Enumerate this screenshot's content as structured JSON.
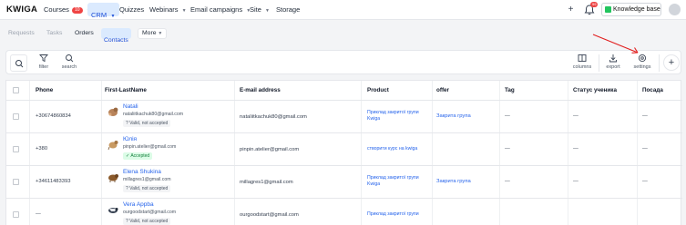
{
  "app": {
    "logo": "KWIGA"
  },
  "topnav": {
    "items": [
      {
        "label": "Courses",
        "badge": "10",
        "chevron": true
      },
      {
        "label": "CRM",
        "chevron": true,
        "active": true
      },
      {
        "label": "Quizzes"
      },
      {
        "label": "Webinars",
        "chevron": true
      },
      {
        "label": "Email campaigns",
        "chevron": true
      },
      {
        "label": "Site",
        "chevron": true
      },
      {
        "label": "Storage"
      }
    ],
    "plus_label": "+",
    "bell_badge": "99",
    "knowledge_base": "Knowledge base"
  },
  "subtabs": {
    "items": [
      "Requests",
      "Tasks",
      "Orders",
      "Contacts"
    ],
    "active": "Contacts",
    "more_label": "More"
  },
  "toolbar": {
    "filter": "filter",
    "search": "search",
    "columns": "columns",
    "export": "export",
    "settings": "settings",
    "add": "+"
  },
  "table": {
    "headers": [
      "Phone",
      "First-LastName",
      "E-mail address",
      "Product",
      "offer",
      "Tag",
      "Статус ученика",
      "Посада"
    ],
    "rows": [
      {
        "phone": "+30674860834",
        "name": "Natali",
        "email_small": "nataliitkachuk80@gmail.com",
        "status": "Valid, not accepted",
        "status_ok": false,
        "email": "nataliitkachuk80@gmail.com",
        "product": [
          "Приклад закритої групи",
          "Kwiga"
        ],
        "offer": "Закрита група",
        "tag": "—",
        "student_status": "—",
        "position": "—"
      },
      {
        "phone": "+380",
        "name": "Юлія",
        "email_small": "pinpin.atelier@gmail.com",
        "status": "Accepted",
        "status_ok": true,
        "email": "pinpin.atelier@gmail.com",
        "product": [
          "створити курс на kwiga"
        ],
        "offer": "",
        "tag": "—",
        "student_status": "—",
        "position": "—"
      },
      {
        "phone": "+34611483393",
        "name": "Elena Shukina",
        "email_small": "millagres1@gmail.com",
        "status": "Valid, not accepted",
        "status_ok": false,
        "email": "millagres1@gmail.com",
        "product": [
          "Приклад закритої групи",
          "Kwiga"
        ],
        "offer": "Закрита група",
        "tag": "—",
        "student_status": "—",
        "position": "—"
      },
      {
        "phone": "—",
        "name": "Vera Appba",
        "email_small": "ourgoodstart@gmail.com",
        "status": "Valid, not accepted",
        "status_ok": false,
        "email": "ourgoodstart@gmail.com",
        "product": [
          "Приклад закритої групи"
        ],
        "offer": "",
        "tag": "",
        "student_status": "",
        "position": ""
      }
    ]
  },
  "colors": {
    "accent": "#2563eb",
    "active_bg": "#dbeafe",
    "arrow": "#e11d1d",
    "badge": "#ef4444"
  }
}
